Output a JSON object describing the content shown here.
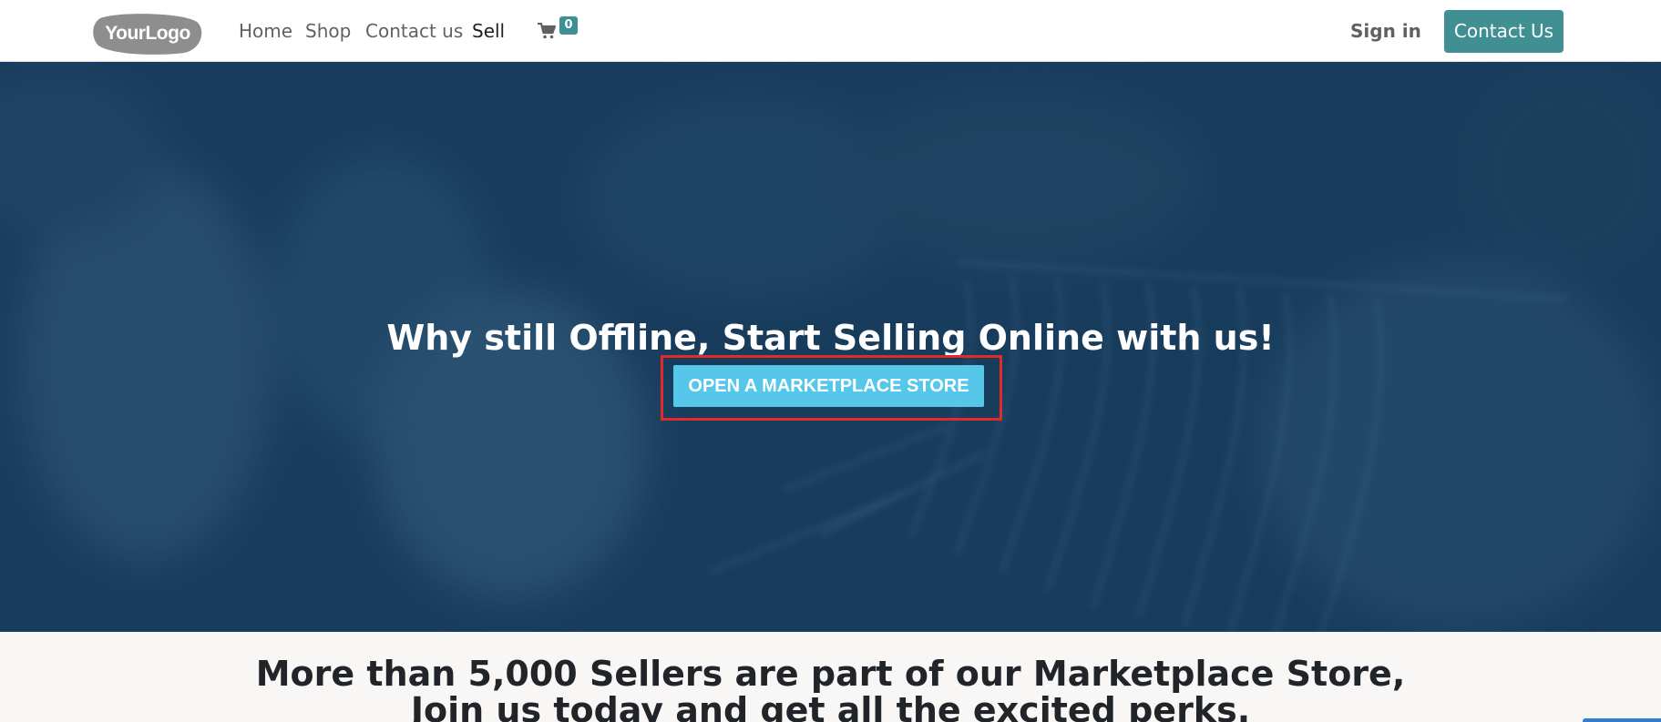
{
  "header": {
    "logo_text": "YourLogo",
    "nav": [
      {
        "label": "Home"
      },
      {
        "label": "Shop"
      },
      {
        "label": "Contact us"
      },
      {
        "label": "Sell"
      }
    ],
    "active_nav": "Sell",
    "cart": {
      "icon": "shopping-cart-icon",
      "count": "0"
    },
    "sign_in": "Sign in",
    "contact_button": "Contact Us",
    "accent_color": "#3f8f93"
  },
  "hero": {
    "title": "Why still Offline, Start Selling Online with us!",
    "cta_label": "OPEN A MARKETPLACE STORE",
    "cta_color": "#56c7eb",
    "overlay_color": "#1a3e5f",
    "highlight_color": "#e22a2a"
  },
  "perks": {
    "line1": "More than 5,000 Sellers are part of our Marketplace Store,",
    "line2": "Join us today and get all the excited perks."
  }
}
